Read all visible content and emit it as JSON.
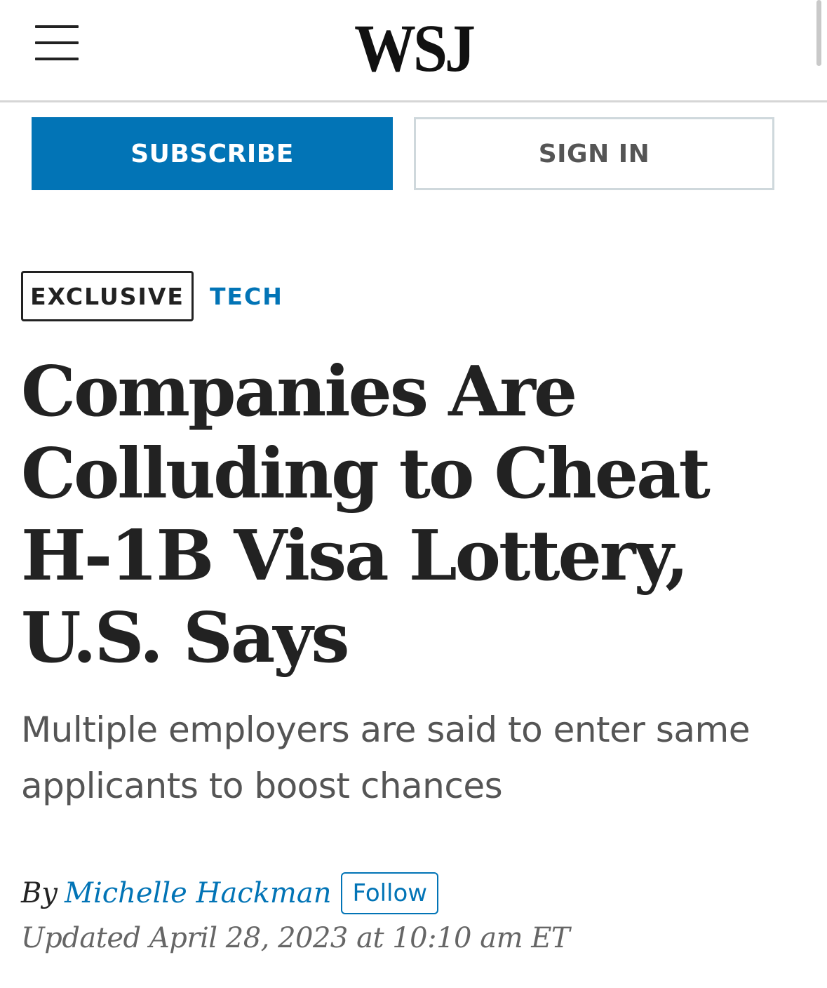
{
  "header": {
    "logo_text": "WSJ",
    "menu_icon": "hamburger-menu-icon"
  },
  "account": {
    "subscribe_label": "SUBSCRIBE",
    "signin_label": "SIGN IN"
  },
  "article": {
    "badge": "EXCLUSIVE",
    "section": "TECH",
    "headline": "Companies Are Colluding to Cheat H-1B Visa Lottery, U.S. Says",
    "dek": "Multiple employers are said to enter same applicants to boost chances",
    "byline_prefix": "By",
    "author": "Michelle Hackman",
    "follow_label": "Follow",
    "timestamp": "Updated April 28, 2023 at 10:10 am ET"
  },
  "colors": {
    "accent_blue": "#0274b6",
    "text_dark": "#222222",
    "text_gray": "#555555"
  }
}
